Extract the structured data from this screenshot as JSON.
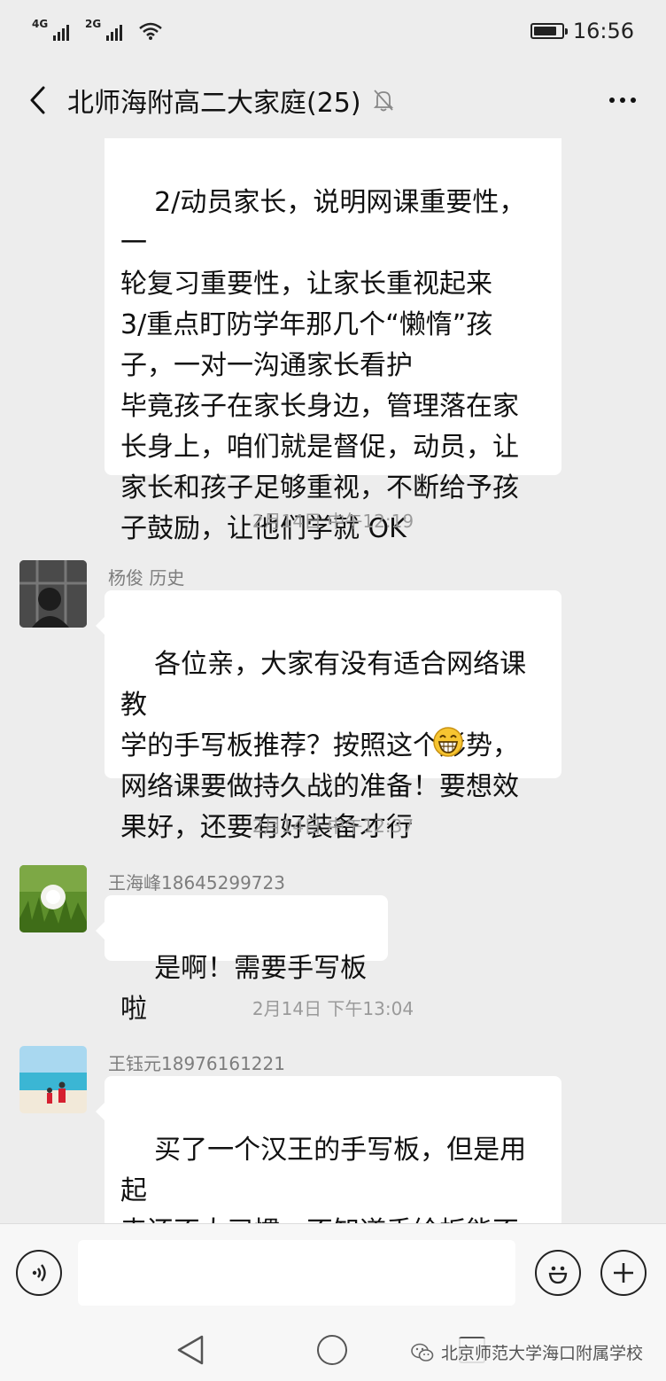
{
  "status_bar": {
    "network_1": "4G",
    "network_2": "2G",
    "time": "16:56",
    "battery_level": 0.85
  },
  "header": {
    "title": "北师海附高二大家庭(25)",
    "back_icon": "chevron-left-icon",
    "mute_icon": "bell-off-icon",
    "more_icon": "more-dots-icon"
  },
  "messages": [
    {
      "type": "text",
      "continued": true,
      "text": "2/动员家长，说明网课重要性，一\n轮复习重要性，让家长重视起来\n3/重点盯防学年那几个“懒惰”孩\n子，一对一沟通家长看护\n毕竟孩子在家长身边，管理落在家\n长身上，咱们就是督促，动员，让\n家长和孩子足够重视，不断给予孩\n子鼓励，让他们学就 OK"
    },
    {
      "type": "time",
      "text": "2月14日 中午12:19"
    },
    {
      "type": "text",
      "sender": "杨俊 历史",
      "text": "各位亲，大家有没有适合网络课教\n学的手写板推荐？按照这个形势，\n网络课要做持久战的准备！要想效\n果好，还要有好装备才行",
      "emoji": "grinning-face-icon"
    },
    {
      "type": "time",
      "text": "2月14日 中午12:37"
    },
    {
      "type": "text",
      "sender": "王海峰18645299723",
      "text": "是啊！需要手写板啦"
    },
    {
      "type": "time",
      "text": "2月14日 下午13:04"
    },
    {
      "type": "text",
      "sender": "王钰元18976161221",
      "text": "买了一个汉王的手写板，但是用起\n来还不太习惯，不知道手绘板能不\n能好一些"
    }
  ],
  "input_bar": {
    "voice_icon": "voice-icon",
    "emoji_icon": "smile-icon",
    "plus_icon": "plus-icon",
    "value": ""
  },
  "system_nav": {
    "watermark": "北京师范大学海口附属学校"
  },
  "colors": {
    "background": "#ededed",
    "bubble": "#ffffff",
    "timestamp": "#9a9a9a"
  }
}
